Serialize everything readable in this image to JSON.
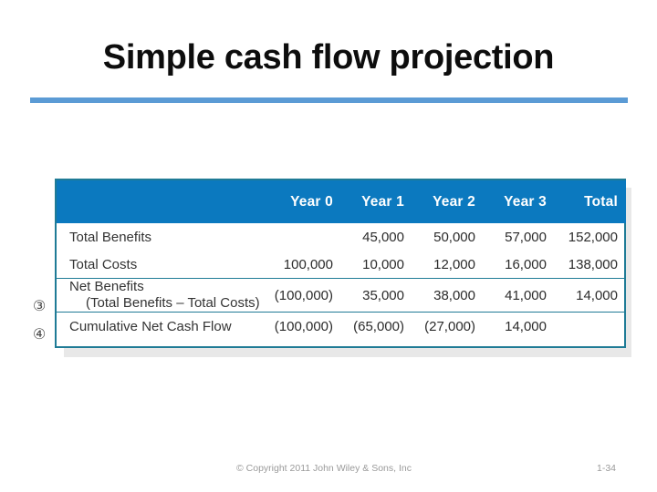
{
  "slide": {
    "title": "Simple cash flow projection",
    "accent_rule_color": "#5b9bd5"
  },
  "table": {
    "header_bg": "#0b79bf",
    "border_color": "#1f7b96",
    "columns": [
      "",
      "Year 0",
      "Year 1",
      "Year 2",
      "Year 3",
      "Total"
    ],
    "row_markers": [
      "③",
      "④"
    ],
    "rows": [
      {
        "label": "Total Benefits",
        "sublabel": "",
        "values": [
          "",
          "45,000",
          "50,000",
          "57,000",
          "152,000"
        ]
      },
      {
        "label": "Total Costs",
        "sublabel": "",
        "values": [
          "100,000",
          "10,000",
          "12,000",
          "16,000",
          "138,000"
        ]
      },
      {
        "label": "Net Benefits",
        "sublabel": "(Total Benefits – Total Costs)",
        "values": [
          "(100,000)",
          "35,000",
          "38,000",
          "41,000",
          "14,000"
        ]
      },
      {
        "label": "Cumulative Net Cash Flow",
        "sublabel": "",
        "values": [
          "(100,000)",
          "(65,000)",
          "(27,000)",
          "14,000",
          ""
        ]
      }
    ]
  },
  "footer": {
    "copyright": "© Copyright 2011 John Wiley & Sons, Inc",
    "page_number": "1-34"
  }
}
